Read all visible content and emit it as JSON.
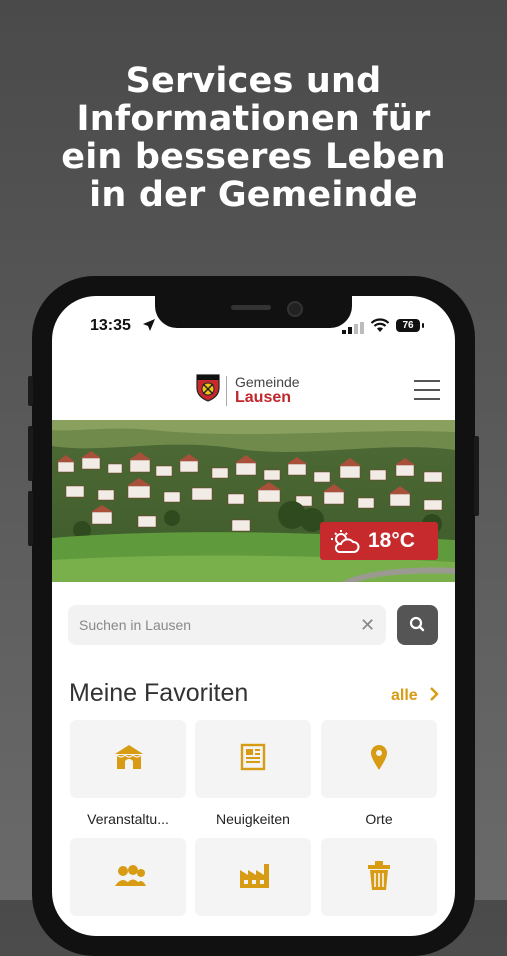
{
  "headline": {
    "line1": "Services und",
    "line2": "Informationen für",
    "line3": "ein besseres Leben",
    "line4": "in der Gemeinde"
  },
  "status_bar": {
    "time": "13:35",
    "battery": "76"
  },
  "header": {
    "logo_top": "Gemeinde",
    "logo_bottom": "Lausen"
  },
  "weather": {
    "temperature": "18°C"
  },
  "search": {
    "placeholder": "Suchen in Lausen",
    "clear_symbol": "✕"
  },
  "favorites": {
    "title": "Meine Favoriten",
    "all_label": "alle",
    "tiles": [
      {
        "label": "Veranstaltu...",
        "icon": "tent-icon"
      },
      {
        "label": "Neuigkeiten",
        "icon": "newspaper-icon"
      },
      {
        "label": "Orte",
        "icon": "map-pin-icon"
      },
      {
        "label": "",
        "icon": "people-icon"
      },
      {
        "label": "",
        "icon": "factory-icon"
      },
      {
        "label": "",
        "icon": "trash-icon"
      }
    ]
  },
  "colors": {
    "accent": "#d79b14",
    "brand_red": "#c62a2d"
  }
}
